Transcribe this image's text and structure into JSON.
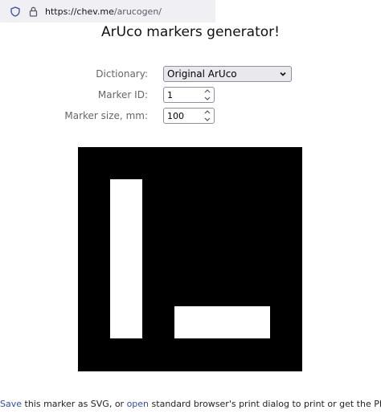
{
  "browser": {
    "url_host": "https://chev.me",
    "url_path": "/arucogen/"
  },
  "page": {
    "title": "ArUco markers generator!"
  },
  "form": {
    "dictionary_label": "Dictionary:",
    "dictionary_value": "Original ArUco",
    "marker_id_label": "Marker ID:",
    "marker_id_value": "1",
    "marker_size_label": "Marker size, mm:",
    "marker_size_value": "100"
  },
  "marker": {
    "colors": {
      "background": "#000000",
      "foreground": "#ffffff"
    }
  },
  "footer": {
    "save_link": "Save",
    "text1": " this marker as SVG, or ",
    "open_link": "open",
    "text2": " standard browser's print dialog to print or get the PDF."
  },
  "colors": {
    "link": "#2f4fa8"
  }
}
